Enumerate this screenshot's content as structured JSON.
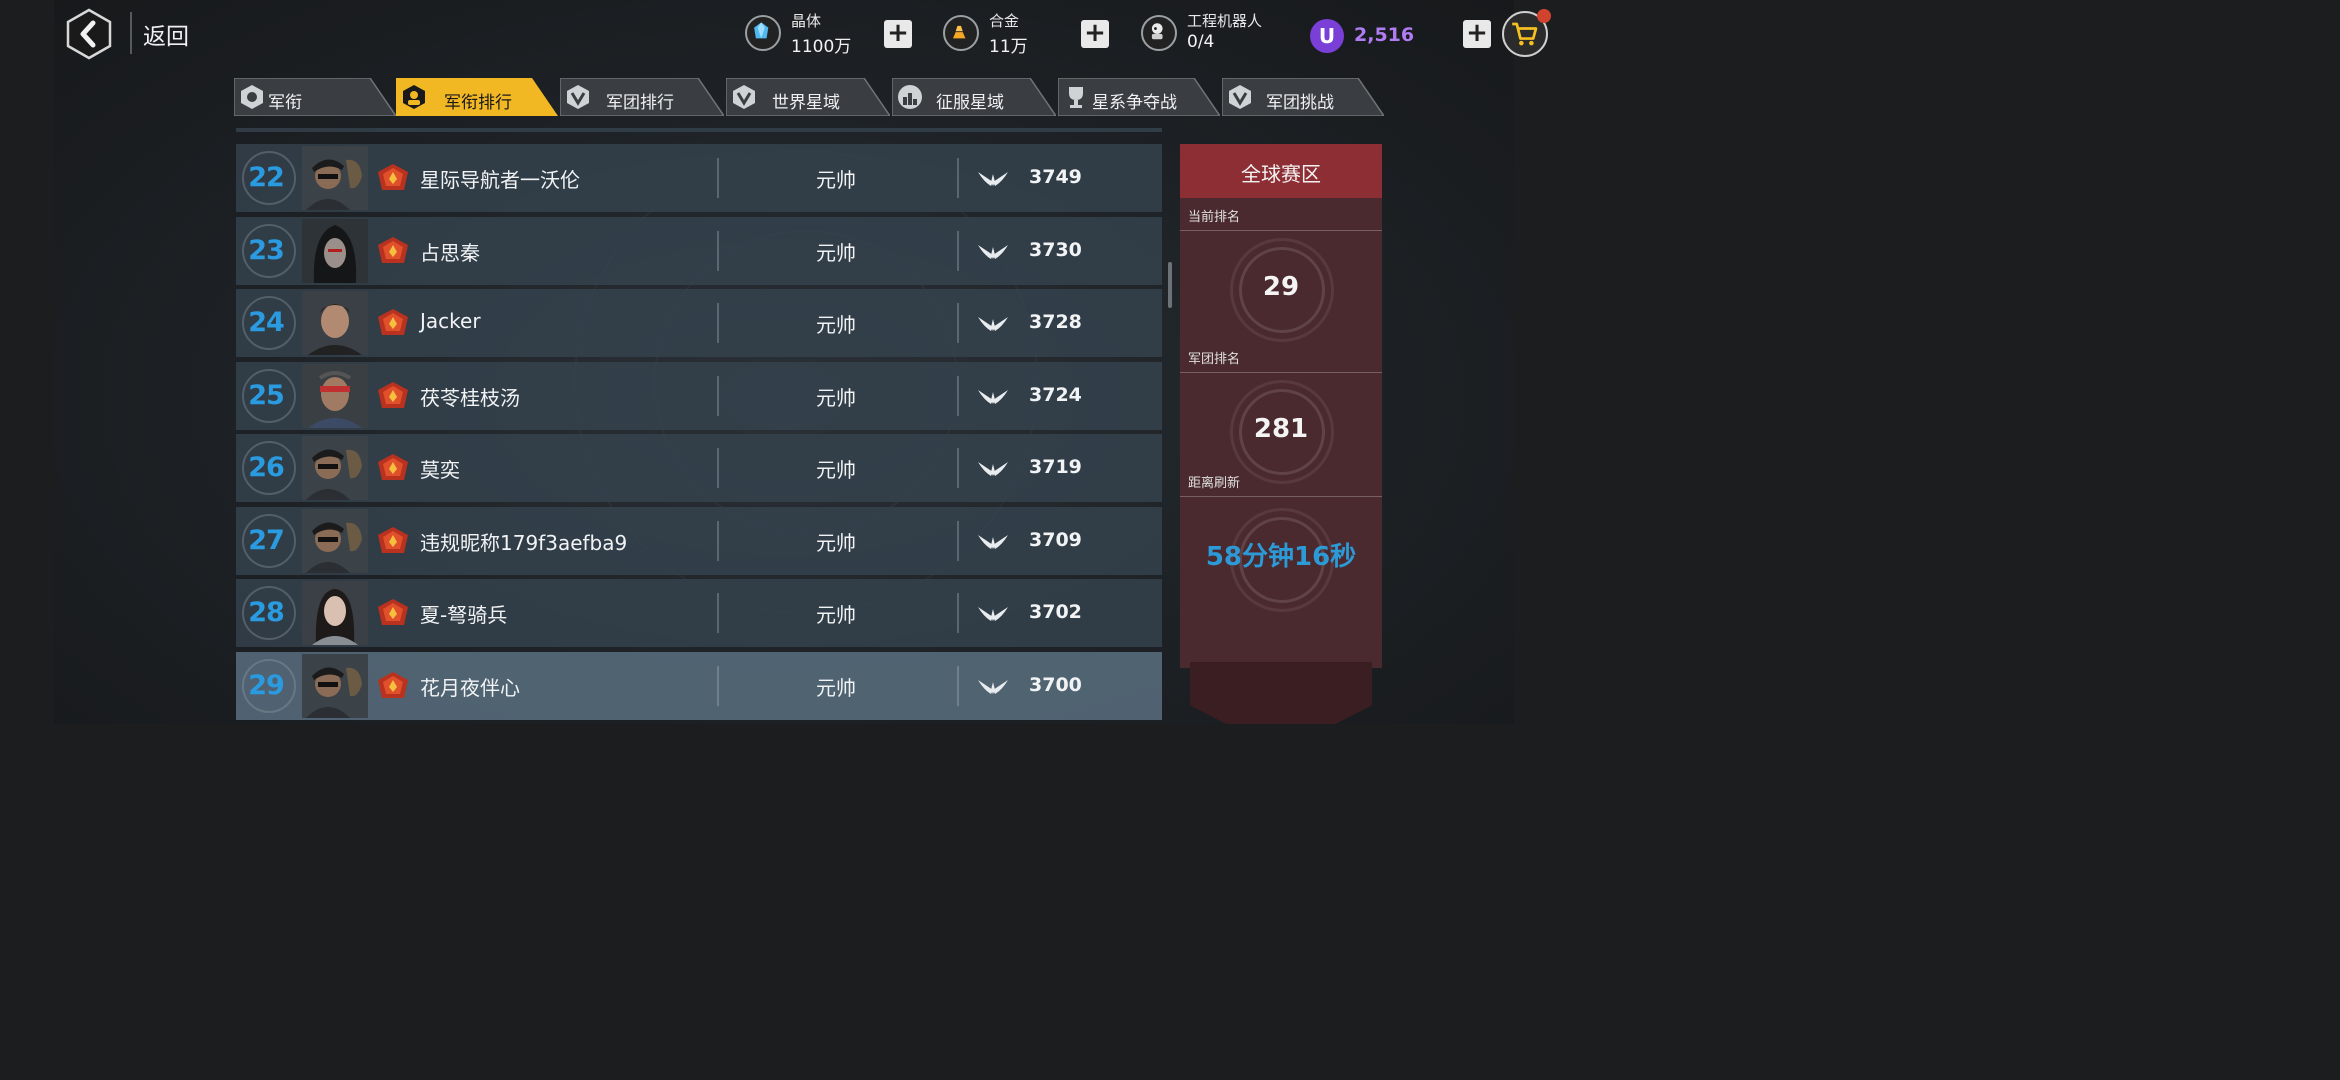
{
  "header": {
    "back_label": "返回",
    "resources": [
      {
        "name": "晶体",
        "value": "1100万",
        "icon": "crystal-icon",
        "color": "#4fb8ef"
      },
      {
        "name": "合金",
        "value": "11万",
        "icon": "alloy-icon",
        "color": "#f5a623"
      },
      {
        "name": "工程机器人",
        "value": "0/4",
        "icon": "robot-icon",
        "color": "#e6e6e6"
      }
    ],
    "premium": {
      "symbol": "U",
      "value": "2,516",
      "color": "#b07cf2"
    },
    "plus_label": "+"
  },
  "tabs": [
    {
      "label": "军衔",
      "active": false
    },
    {
      "label": "军衔排行",
      "active": true
    },
    {
      "label": "军团排行",
      "active": false
    },
    {
      "label": "世界星域",
      "active": false
    },
    {
      "label": "征服星域",
      "active": false
    },
    {
      "label": "星系争夺战",
      "active": false
    },
    {
      "label": "军团挑战",
      "active": false
    }
  ],
  "ranking": [
    {
      "rank": "22",
      "name": "星际导航者一沃伦",
      "title": "元帅",
      "score": "3749",
      "avatar": "soldier"
    },
    {
      "rank": "23",
      "name": "占思秦",
      "title": "元帅",
      "score": "3730",
      "avatar": "hooded"
    },
    {
      "rank": "24",
      "name": "Jacker",
      "title": "元帅",
      "score": "3728",
      "avatar": "man"
    },
    {
      "rank": "25",
      "name": "茯苓桂枝汤",
      "title": "元帅",
      "score": "3724",
      "avatar": "cyborg"
    },
    {
      "rank": "26",
      "name": "莫奕",
      "title": "元帅",
      "score": "3719",
      "avatar": "soldier"
    },
    {
      "rank": "27",
      "name": "违规昵称179f3aefba9",
      "title": "元帅",
      "score": "3709",
      "avatar": "soldier"
    },
    {
      "rank": "28",
      "name": "夏-弩骑兵",
      "title": "元帅",
      "score": "3702",
      "avatar": "woman"
    },
    {
      "rank": "29",
      "name": "花月夜伴心",
      "title": "元帅",
      "score": "3700",
      "avatar": "soldier",
      "highlight": true
    }
  ],
  "side_panel": {
    "title": "全球赛区",
    "current_rank_label": "当前排名",
    "current_rank": "29",
    "legion_rank_label": "军团排名",
    "legion_rank": "281",
    "refresh_label": "距离刷新",
    "refresh_time": "58分钟16秒"
  },
  "colors": {
    "accent_tab": "#f2b824",
    "rank_blue": "#2a9be0",
    "panel_red": "#8c2e34"
  }
}
